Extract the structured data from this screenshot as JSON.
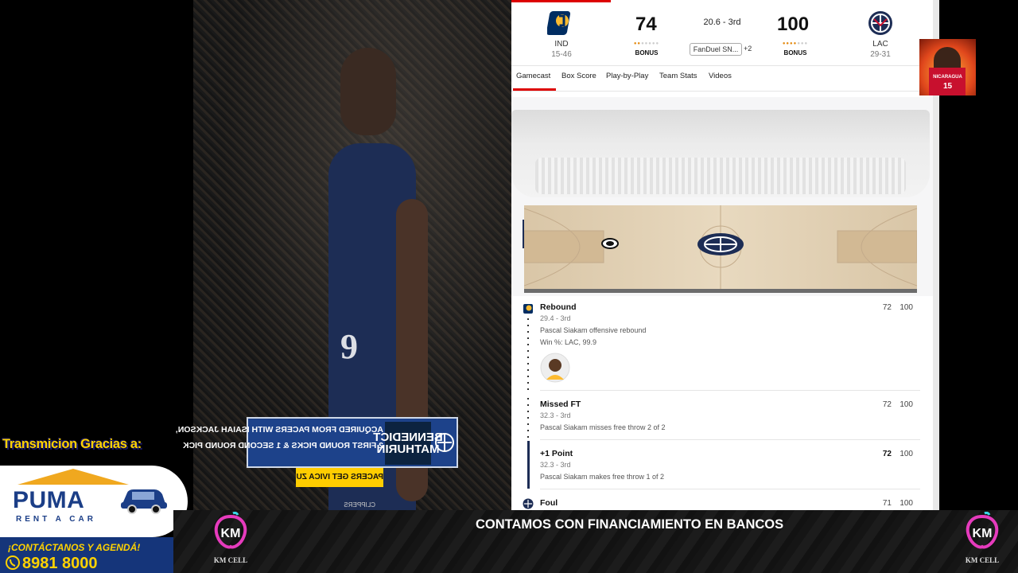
{
  "video": {
    "player_number": "9",
    "lower_third": {
      "name_line": "BENNEDICT MATHURIN",
      "line1": "ACQUIRED FROM PACERS WITH ISAIAH JACKSON,",
      "line2": "2 FIRST ROUND PICKS & 1 SECOND ROUND PICK",
      "ticker": "PACERS GET IVICA ZUBAC & KOBE BROWN",
      "small": "CLIPPERS"
    }
  },
  "scoreboard": {
    "home": {
      "abbr": "IND",
      "record": "15-46",
      "score": "74",
      "bonus": "BONUS"
    },
    "away": {
      "abbr": "LAC",
      "record": "29-31",
      "score": "100",
      "bonus": "BONUS"
    },
    "clock": "20.6 - 3rd",
    "odds_provider": "FanDuel SN...",
    "odds_more": "+2",
    "colors": {
      "accent": "#d00000",
      "ind": "#002d62",
      "ind_gold": "#fdbb30",
      "lac": "#1d428a"
    }
  },
  "tabs": [
    "Gamecast",
    "Box Score",
    "Play-by-Play",
    "Team Stats",
    "Videos"
  ],
  "plays": [
    {
      "title": "Rebound",
      "time": "29.4 - 3rd",
      "desc": "Pascal Siakam offensive rebound",
      "extra": "Win %: LAC, 99.9",
      "score_ind": "72",
      "score_lac": "100",
      "team": "ind-logo-icon"
    },
    {
      "title": "Missed FT",
      "time": "32.3 - 3rd",
      "desc": "Pascal Siakam misses free throw 2 of 2",
      "score_ind": "72",
      "score_lac": "100"
    },
    {
      "title": "+1 Point",
      "time": "32.3 - 3rd",
      "desc": "Pascal Siakam makes free throw 1 of 2",
      "score_ind": "72",
      "score_lac": "100"
    },
    {
      "title": "Foul",
      "score_ind": "71",
      "score_lac": "100",
      "team": "lac-logo-icon"
    }
  ],
  "avatar": {
    "text": "NICARAGUA",
    "number": "15"
  },
  "sponsor": {
    "heading": "Transmicion Gracias a:",
    "brand": "PUMA",
    "brand_sub": "RENT A CAR",
    "contact_line1": "¡CONTÁCTANOS Y AGENDÁ!",
    "contact_phone": "8981 8000"
  },
  "banner": {
    "text": "CONTAMOS CON FINANCIAMIENTO EN BANCOS",
    "left_logo_label": "KM CELL",
    "right_logo_label": "KM CELL"
  }
}
